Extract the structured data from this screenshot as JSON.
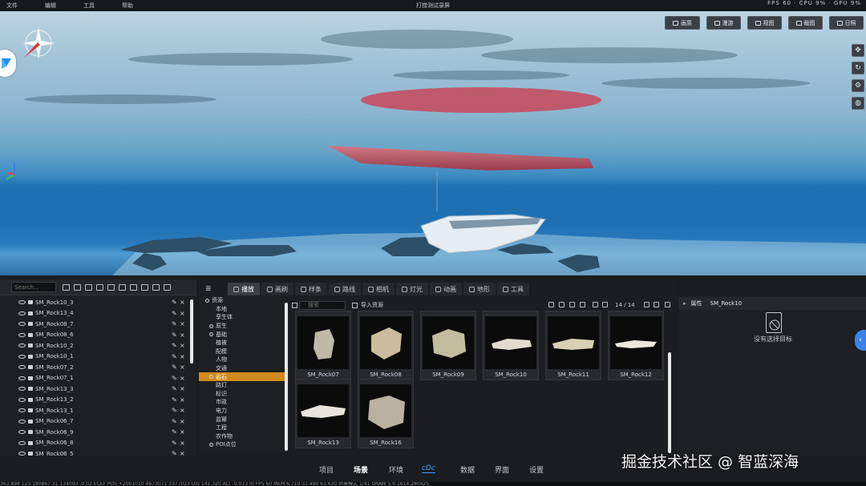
{
  "menubar": {
    "items": [
      "文件",
      "编辑",
      "工具",
      "帮助"
    ],
    "title": "打捞测试录屏",
    "right_status": "FPS 60 · CPU 9% · GPU 9%"
  },
  "viewport": {
    "buttons": [
      "画质",
      "漫游",
      "视图",
      "截图",
      "日照"
    ],
    "side_tools": [
      "move-icon",
      "rotate-icon",
      "gear-icon",
      "globe-icon"
    ],
    "axis": {
      "z": "Z"
    }
  },
  "outliner": {
    "search_placeholder": "Search...",
    "rows": [
      "SM_Rock10_3",
      "SM_Rock13_4",
      "SM_Rock08_7",
      "SM_Rock08_6",
      "SM_Rock10_2",
      "SM_Rock10_1",
      "SM_Rock07_2",
      "SM_Rock07_1",
      "SM_Rock13_3",
      "SM_Rock13_2",
      "SM_Rock13_1",
      "SM_Rock06_7",
      "SM_Rock06_9",
      "SM_Rock06_8",
      "SM_Rock06_5"
    ]
  },
  "tabs": [
    {
      "label": "播放",
      "active": true
    },
    {
      "label": "画刷",
      "active": false
    },
    {
      "label": "样条",
      "active": false
    },
    {
      "label": "路线",
      "active": false
    },
    {
      "label": "相机",
      "active": false
    },
    {
      "label": "灯光",
      "active": false
    },
    {
      "label": "动画",
      "active": false
    },
    {
      "label": "地形",
      "active": false
    },
    {
      "label": "工具",
      "active": false
    }
  ],
  "tree": {
    "items": [
      "资源",
      "本地",
      "孪生体",
      "原生",
      "基础",
      "植被",
      "配模",
      "人物",
      "交通",
      "岩石",
      "路灯",
      "标识",
      "市政",
      "电力",
      "监幂",
      "工程",
      "农作物",
      "POI点位"
    ],
    "selected": "岩石"
  },
  "assets": {
    "search_placeholder": "搜索",
    "import_label": "导入资源",
    "page": "14 / 14",
    "items": [
      "SM_Rock07",
      "SM_Rock08",
      "SM_Rock09",
      "SM_Rock10",
      "SM_Rock11",
      "SM_Rock12",
      "SM_Rock13",
      "SM_Rock16"
    ]
  },
  "properties": {
    "title": "属性",
    "object": "SM_Rock10",
    "empty_text": "没有选择目标"
  },
  "bottom_nav": {
    "items": [
      "项目",
      "场景",
      "环境",
      "数据",
      "界面",
      "设置"
    ],
    "active": "场景",
    "logo": "cDc"
  },
  "watermark": "掘金技术社区 @ 智蓝深海",
  "statusbar": "363.898 123.180867 31.134093 -0.02 ECEF POS +2001010 4673071 3377023 DIS 141.320 ALT -0.073 m FPS 60 MEM 6.710 31.490 63.630 场景模式 1/41 DRAW 5.0.1614.280425",
  "colors": {
    "accent": "#d18a1d",
    "side_tab": "#3b82e6",
    "water": "#1d6fb2"
  }
}
